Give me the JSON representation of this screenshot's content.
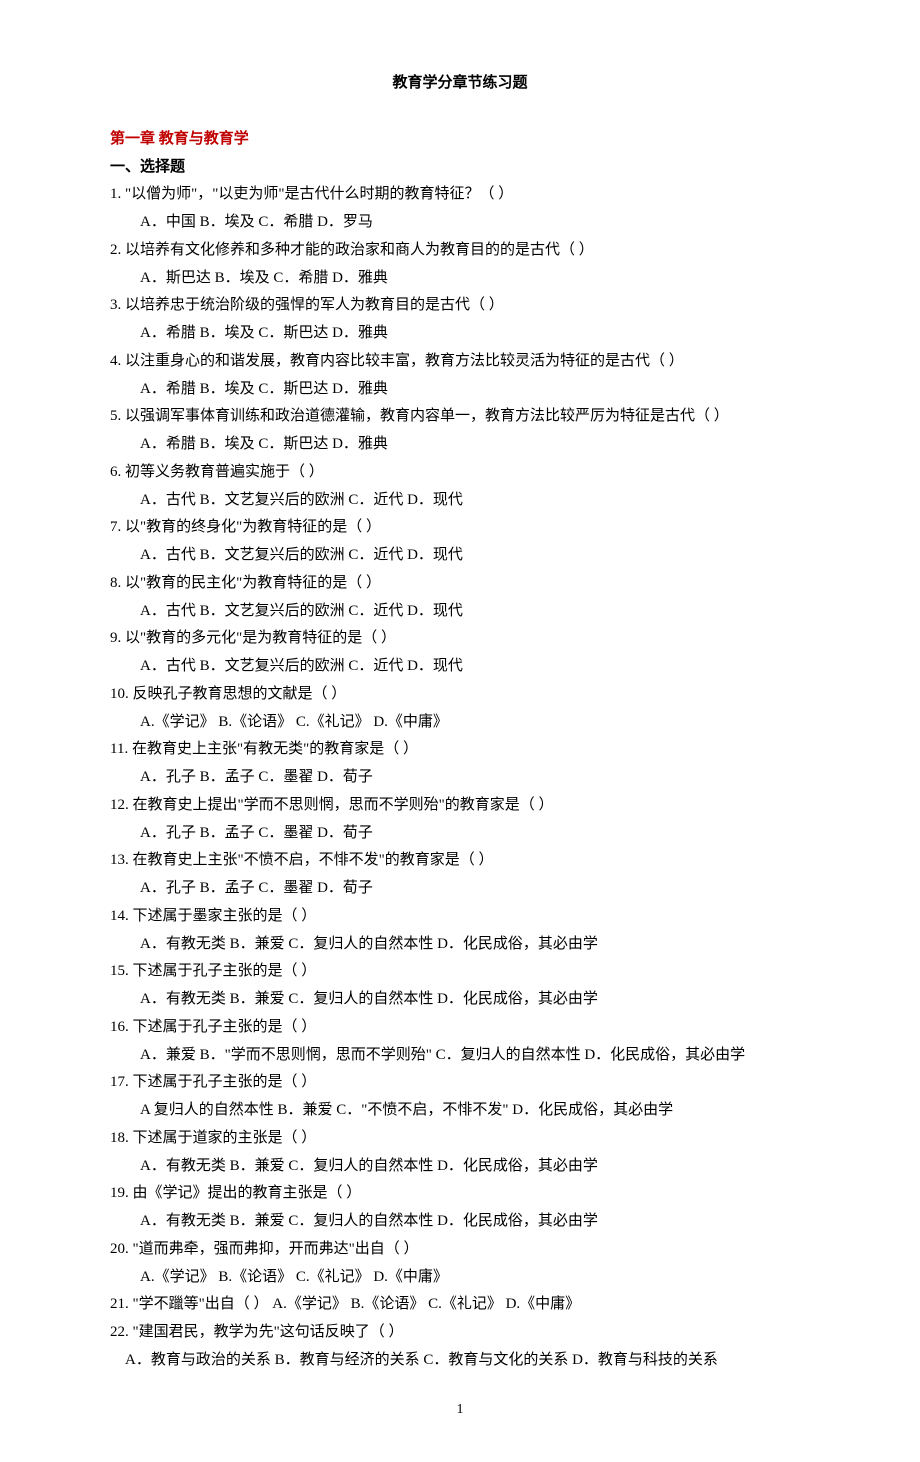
{
  "title": "教育学分章节练习题",
  "chapter": "第一章 教育与教育学",
  "section_heading": "一、选择题",
  "page_number": "1",
  "questions": [
    {
      "num": "1.",
      "text": "\"以僧为师\"，\"以吏为师\"是古代什么时期的教育特征？（ ）",
      "options": "A．中国 B．埃及 C．希腊 D．罗马"
    },
    {
      "num": "2.",
      "text": "以培养有文化修养和多种才能的政治家和商人为教育目的的是古代（ ）",
      "options": "A．斯巴达 B．埃及 C．希腊 D．雅典"
    },
    {
      "num": "3.",
      "text": "以培养忠于统治阶级的强悍的军人为教育目的是古代（ ）",
      "options": "A．希腊 B．埃及 C．斯巴达 D．雅典"
    },
    {
      "num": "4.",
      "text": "以注重身心的和谐发展，教育内容比较丰富，教育方法比较灵活为特征的是古代（ ）",
      "options": "A．希腊 B．埃及 C．斯巴达 D．雅典"
    },
    {
      "num": "5.",
      "text": "以强调军事体育训练和政治道德灌输，教育内容单一，教育方法比较严厉为特征是古代（ ）",
      "options": "A．希腊 B．埃及 C．斯巴达 D．雅典"
    },
    {
      "num": "6.",
      "text": "初等义务教育普遍实施于（ ）",
      "options": "A．古代 B．文艺复兴后的欧洲 C．近代 D．现代"
    },
    {
      "num": "7.",
      "text": "以\"教育的终身化\"为教育特征的是（ ）",
      "options": "A．古代 B．文艺复兴后的欧洲 C．近代 D．现代"
    },
    {
      "num": "8.",
      "text": "以\"教育的民主化\"为教育特征的是（ ）",
      "options": "A．古代 B．文艺复兴后的欧洲 C．近代 D．现代"
    },
    {
      "num": "9.",
      "text": "以\"教育的多元化\"是为教育特征的是（ ）",
      "options": "A．古代 B．文艺复兴后的欧洲 C．近代 D．现代"
    },
    {
      "num": "10.",
      "text": "反映孔子教育思想的文献是（ ）",
      "options": "A.《学记》 B.《论语》 C.《礼记》 D.《中庸》"
    },
    {
      "num": "11.",
      "text": "在教育史上主张\"有教无类\"的教育家是（ ）",
      "options": "A．孔子 B．孟子 C．墨翟 D．荀子"
    },
    {
      "num": "12.",
      "text": "在教育史上提出\"学而不思则惘，思而不学则殆\"的教育家是（ ）",
      "options": "A．孔子 B．孟子 C．墨翟 D．荀子"
    },
    {
      "num": "13.",
      "text": "在教育史上主张\"不愤不启，不悱不发\"的教育家是（ ）",
      "options": "A．孔子 B．孟子 C．墨翟 D．荀子"
    },
    {
      "num": "14.",
      "text": "下述属于墨家主张的是（ ）",
      "options": "A．有教无类 B．兼爱 C．复归人的自然本性 D．化民成俗，其必由学"
    },
    {
      "num": "15.",
      "text": "下述属于孔子主张的是（ ）",
      "options": "A．有教无类 B．兼爱 C．复归人的自然本性 D．化民成俗，其必由学"
    },
    {
      "num": "16.",
      "text": "下述属于孔子主张的是（ ）",
      "options": "A．兼爱 B．\"学而不思则惘，思而不学则殆\" C．复归人的自然本性 D．化民成俗，其必由学"
    },
    {
      "num": "17.",
      "text": "下述属于孔子主张的是（ ）",
      "options": "A 复归人的自然本性 B．兼爱 C．\"不愤不启，不悱不发\" D．化民成俗，其必由学"
    },
    {
      "num": "18.",
      "text": "下述属于道家的主张是（ ）",
      "options": "A．有教无类 B．兼爱 C．复归人的自然本性 D．化民成俗，其必由学"
    },
    {
      "num": "19.",
      "text": "由《学记》提出的教育主张是（ ）",
      "options": "A．有教无类 B．兼爱 C．复归人的自然本性 D．化民成俗，其必由学"
    },
    {
      "num": "20.",
      "text": "\"道而弗牵，强而弗抑，开而弗达\"出自（ ）",
      "options": "A.《学记》 B.《论语》 C.《礼记》 D.《中庸》"
    }
  ],
  "q21": {
    "num": "21.",
    "text": "\"学不躐等\"出自（ ）",
    "options": "A.《学记》 B.《论语》 C.《礼记》 D.《中庸》"
  },
  "q22": {
    "num": "22.",
    "text": "\"建国君民，教学为先\"这句话反映了（ ）",
    "options": "A．教育与政治的关系 B．教育与经济的关系 C．教育与文化的关系 D．教育与科技的关系"
  }
}
